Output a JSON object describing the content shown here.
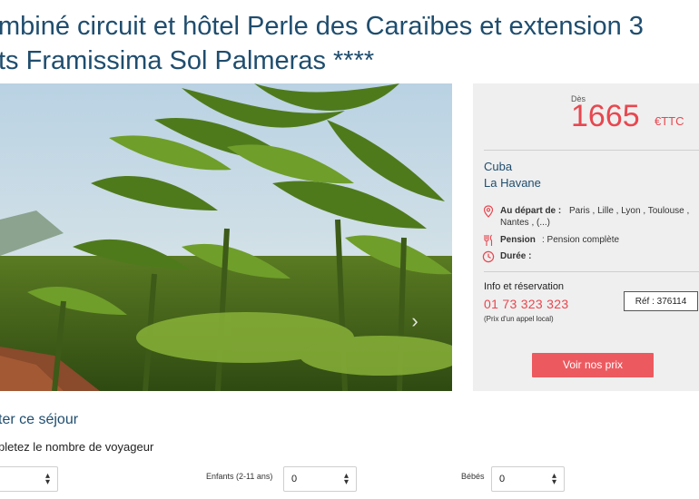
{
  "title": {
    "line1": "mbiné circuit et hôtel Perle des Caraïbes et extension 3",
    "line2": "ts Framissima Sol Palmeras ****"
  },
  "carousel": {
    "next_icon": "chevron-right-icon",
    "next_glyph": "›"
  },
  "price": {
    "from_label": "Dès",
    "amount": "1665",
    "currency": "€TTC"
  },
  "destination": {
    "country": "Cuba",
    "city": "La Havane"
  },
  "details": {
    "departure_label": "Au départ de :",
    "departure_value_line1": "Paris , Lille , Lyon , Toulouse ,",
    "departure_value_line2": "Nantes , (...)",
    "pension_label": "Pension",
    "pension_value": ": Pension complète",
    "duration_label": "Durée :",
    "duration_value": ""
  },
  "booking": {
    "title": "Info et réservation",
    "phone": "01 73 323 323",
    "phone_note": "(Prix d'un appel local)",
    "ref": "Réf : 376114",
    "cta_label": "Voir nos prix"
  },
  "travelers": {
    "section_title": "ter ce séjour",
    "section_subtitle": "pletez le nombre de voyageur",
    "fields": [
      {
        "label": "",
        "value": ""
      },
      {
        "label": "Enfants (2-11 ans)",
        "value": "0"
      },
      {
        "label": "Bébés",
        "value": "0"
      }
    ]
  },
  "colors": {
    "accent_red": "#e8474f",
    "title_blue": "#1f4d6e",
    "panel_bg": "#efefef"
  }
}
